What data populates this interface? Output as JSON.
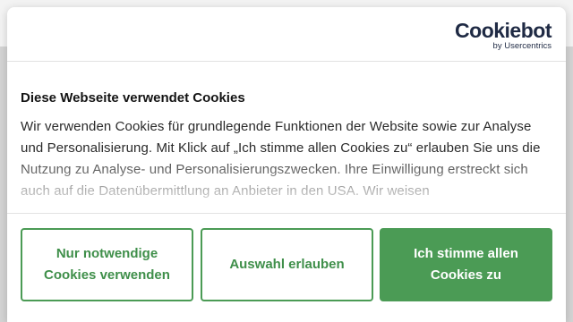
{
  "logo": {
    "main": "Cookiebot",
    "sub": "by Usercentrics"
  },
  "dialog": {
    "title": "Diese Webseite verwendet Cookies",
    "body": "Wir verwenden Cookies für grundlegende Funktionen der Website sowie zur Analyse und Personalisierung. Mit Klick auf „Ich stimme allen Cookies zu“ erlauben Sie uns die Nutzung zu Analyse- und Personalisierungszwecken. Ihre Einwilligung erstreckt sich auch auf die Datenübermittlung an Anbieter in den USA. Wir weisen"
  },
  "buttons": {
    "necessary": "Nur notwendige Cookies verwenden",
    "selection": "Auswahl erlauben",
    "accept_all": "Ich stimme allen Cookies zu"
  },
  "colors": {
    "accent": "#4b9b55",
    "logo": "#1f2a44"
  }
}
